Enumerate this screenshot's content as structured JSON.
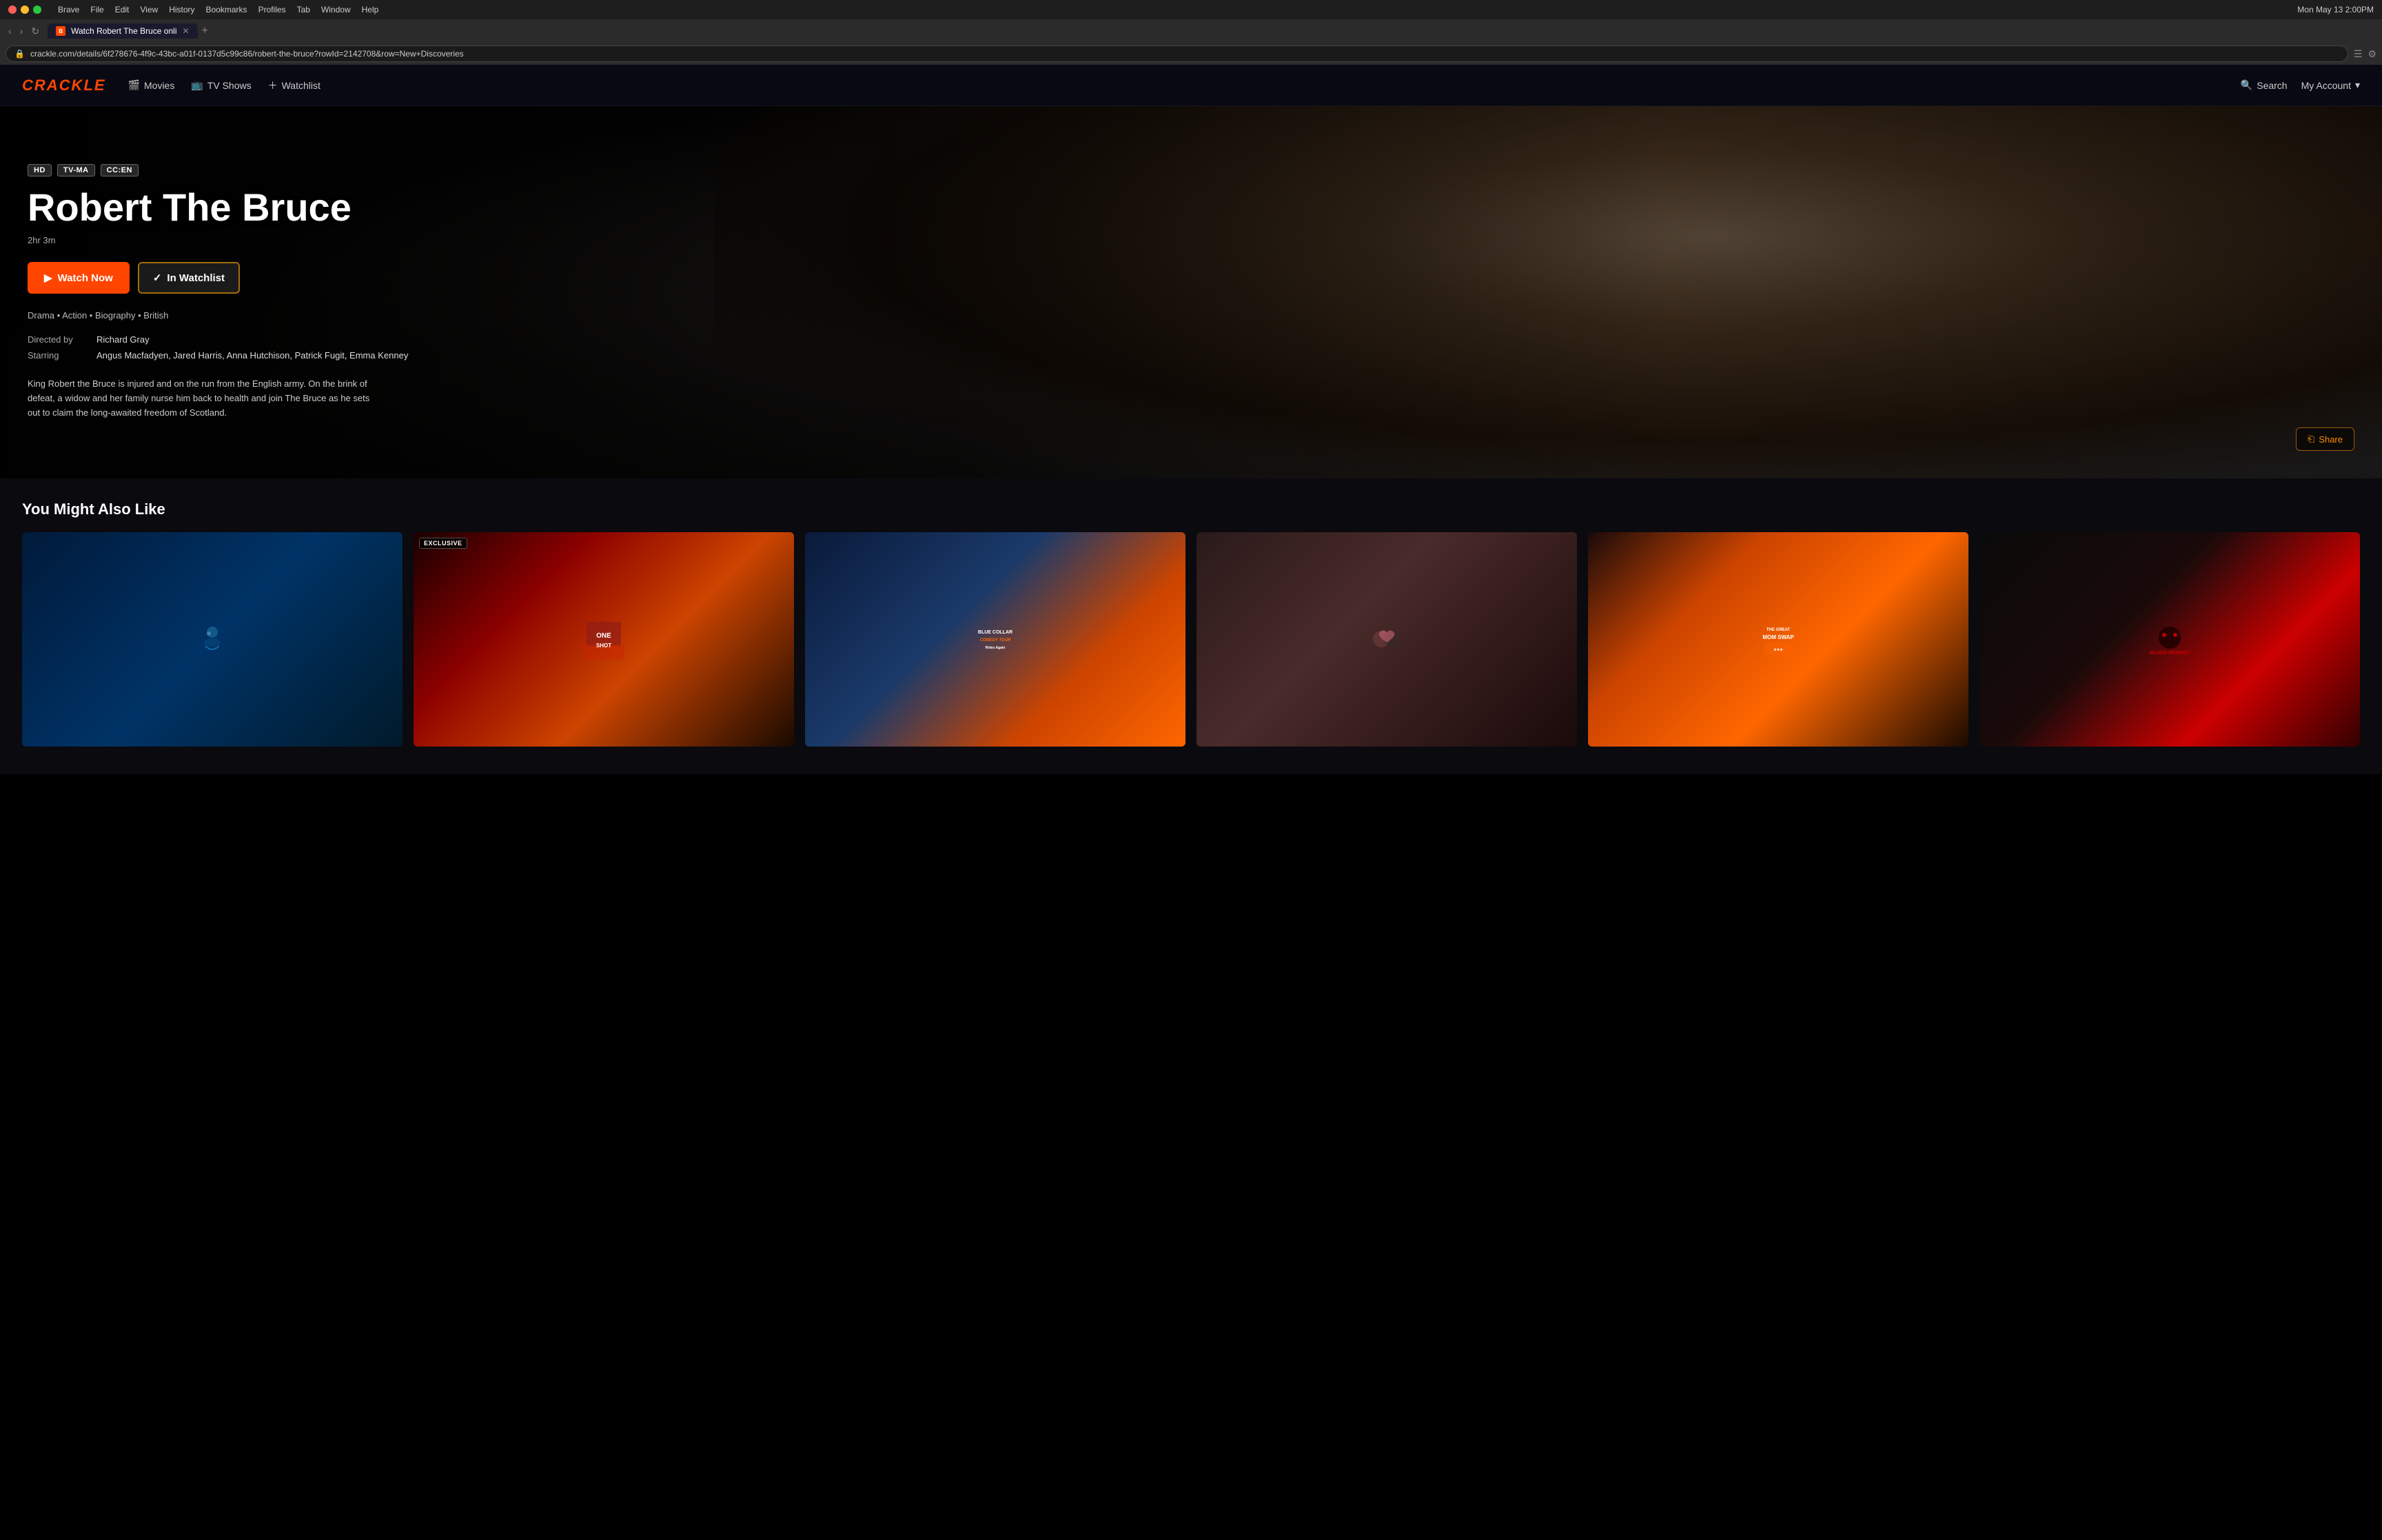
{
  "browser": {
    "title": "Watch Robert The Bruce onli",
    "url": "crackle.com/details/6f278676-4f9c-43bc-a01f-0137d5c99c86/robert-the-bruce?rowId=2142708&row=New+Discoveries",
    "menu_items": [
      "Brave",
      "File",
      "Edit",
      "View",
      "History",
      "Bookmarks",
      "Profiles",
      "Tab",
      "Window",
      "Help"
    ],
    "datetime": "Mon May 13  2:00PM",
    "tab_label": "Watch Robert The Bruce onli",
    "new_tab_label": "+"
  },
  "nav_buttons": {
    "back": "‹",
    "forward": "›",
    "reload": "↻"
  },
  "site": {
    "logo": "CRACKLE",
    "nav": {
      "movies_label": "Movies",
      "tvshows_label": "TV Shows",
      "watchlist_label": "Watchlist"
    },
    "header_right": {
      "search_label": "Search",
      "account_label": "My Account"
    }
  },
  "hero": {
    "badges": [
      "HD",
      "TV-MA",
      "CC:EN"
    ],
    "title": "Robert The Bruce",
    "duration": "2hr 3m",
    "watch_now": "Watch Now",
    "in_watchlist": "In Watchlist",
    "genres": "Drama • Action • Biography • British",
    "directed_by_label": "Directed by",
    "director": "Richard Gray",
    "starring_label": "Starring",
    "cast": "Angus Macfadyen, Jared Harris, Anna Hutchison, Patrick Fugit, Emma Kenney",
    "description": "King Robert the Bruce is injured and on the run from the English army. On the brink of defeat, a widow and her family nurse him back to health and join The Bruce as he sets out to claim the long-awaited freedom of Scotland.",
    "share_label": "Share"
  },
  "recommendations": {
    "section_title": "You Might Also Like",
    "movies": [
      {
        "id": 1,
        "title": "Diver Film",
        "badge": null,
        "exclusive": false,
        "color_class": "card-1"
      },
      {
        "id": 2,
        "title": "One Shot",
        "badge": null,
        "exclusive": true,
        "exclusive_label": "EXCLUSIVE",
        "color_class": "card-2"
      },
      {
        "id": 3,
        "title": "Blue Collar Comedy Tour Rides Again",
        "badge": null,
        "exclusive": false,
        "color_class": "card-3"
      },
      {
        "id": 4,
        "title": "Romance Film",
        "badge": null,
        "exclusive": false,
        "color_class": "card-4"
      },
      {
        "id": 5,
        "title": "The Great Mom Swap",
        "badge": null,
        "exclusive": false,
        "color_class": "card-5"
      },
      {
        "id": 6,
        "title": "Blood Monkey",
        "badge": null,
        "exclusive": false,
        "color_class": "card-6"
      }
    ]
  },
  "icons": {
    "play": "▶",
    "check": "✓",
    "search": "🔍",
    "chevron_down": "▾",
    "share": "⎗",
    "movie_reel": "🎬",
    "tv": "📺",
    "plus": "+"
  }
}
